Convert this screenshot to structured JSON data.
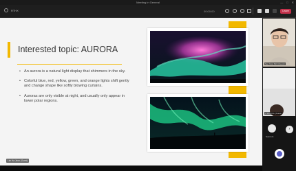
{
  "window": {
    "title": "Meeting in General",
    "controls": [
      "—",
      "□",
      "✕"
    ]
  },
  "toolbar": {
    "app_label": "RTHX",
    "timer": "00:00:00",
    "leave_label": "Leave"
  },
  "slide": {
    "title": "Interested topic: AURORA",
    "bullets": [
      "An aurora is a natural light display that shimmers in the sky.",
      "Colorful blue, red, yellow, green, and orange lights shift gently and change shape like softly blowing curtains.",
      "Auroras are only visible at night, and usually only appear in lower polar regions."
    ],
    "presenter_tag": "Lim Ha Jeon (Guest)",
    "accent_color": "#f2b800"
  },
  "participants": {
    "tile1_name": "Seo Yeon Park (Guest)",
    "tile2_name": "Ji Woo Kim (Guest)",
    "mini_name": "Sumin K.",
    "nav_arrow": "›"
  }
}
